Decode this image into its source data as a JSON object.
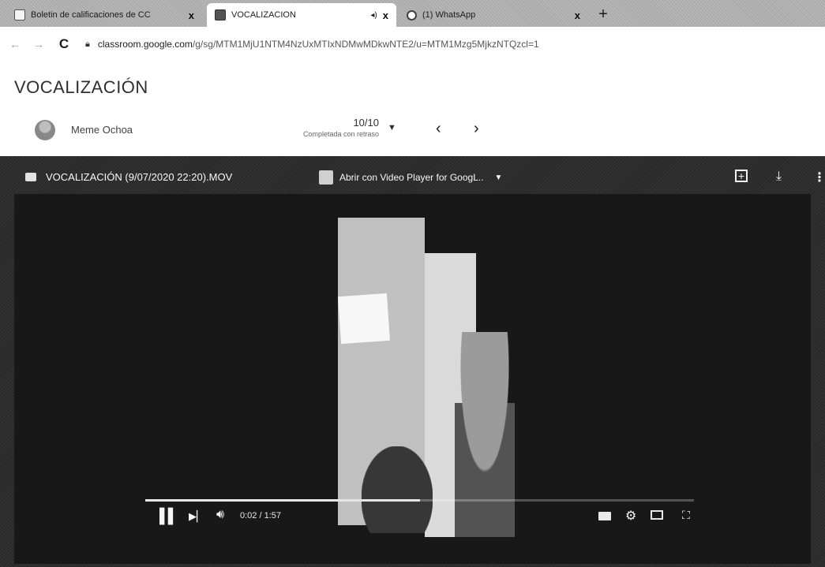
{
  "browser": {
    "tabs": [
      {
        "title": "Boletin de calificaciones de CC",
        "icon": "document-icon",
        "active": false
      },
      {
        "title": "VOCALIZACION",
        "icon": "classroom-icon",
        "active": true
      },
      {
        "title": "(1) WhatsApp",
        "icon": "whatsapp-icon",
        "active": false
      }
    ],
    "tab_close_glyph": "x",
    "new_tab_glyph": "+",
    "address": {
      "host": "classroom.google.com",
      "path": "/g/sg/MTM1MjU1NTM4NzUxMTIxNDMwMDkwNTE2/u=MTM1Mzg5MjkzNTQzcl=1"
    }
  },
  "page": {
    "title": "VOCALIZACIÓN",
    "student": {
      "name": "Meme Ochoa"
    },
    "grade": {
      "value": "10/10",
      "status": "Completada con retraso"
    }
  },
  "viewer": {
    "file_name": "VOCALIZACIÓN (9/07/2020 22:20).MOV",
    "open_with_label": "Abrir con Video Player for GoogL..",
    "player": {
      "current_time": "0:02",
      "duration": "1:57",
      "time_display": "0:02 / 1:57",
      "buffered_fraction": 0.5
    }
  }
}
